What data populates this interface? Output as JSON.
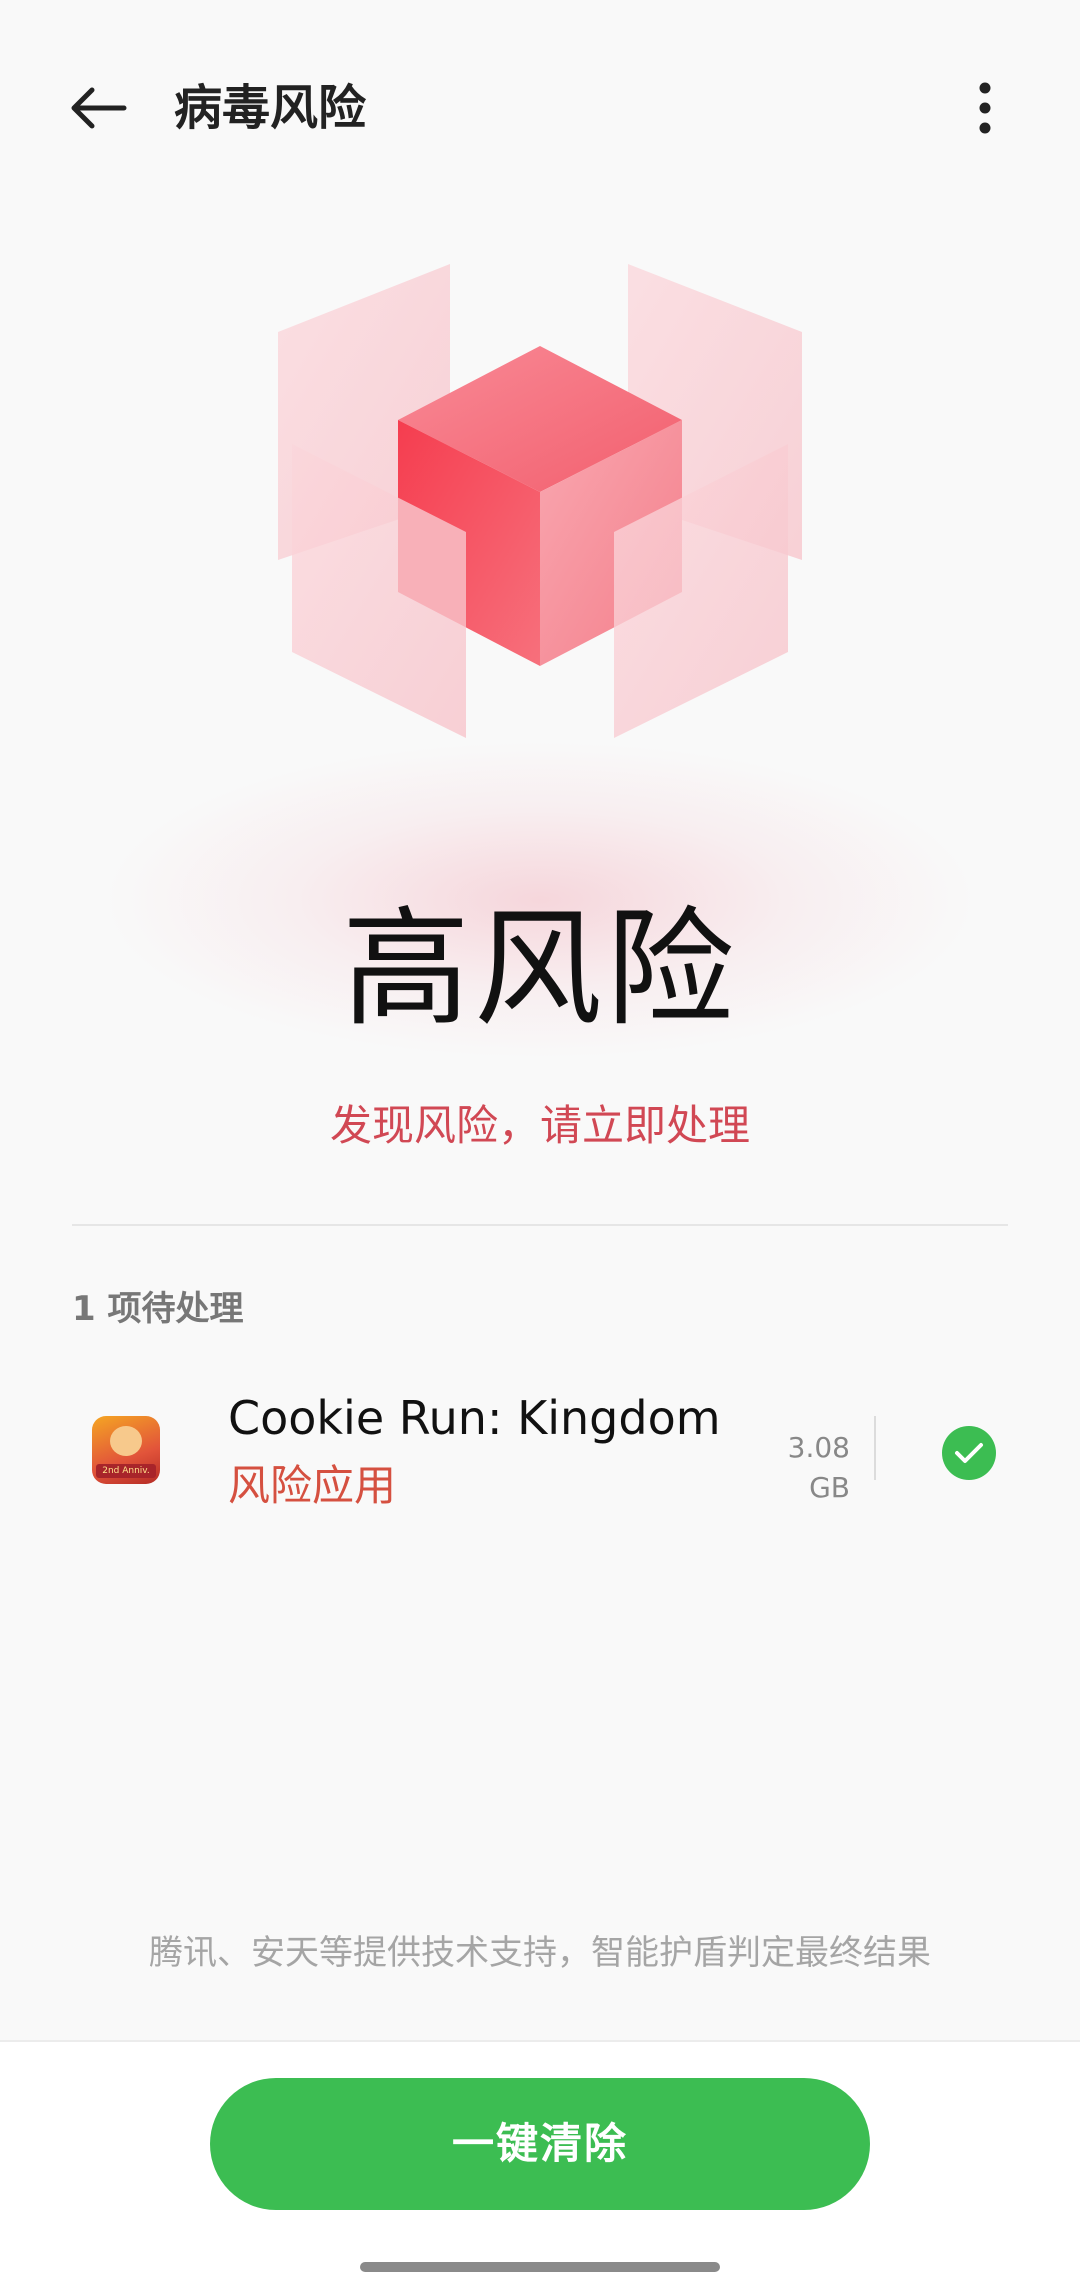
{
  "header": {
    "title": "病毒风险",
    "back_icon": "arrow-left-icon",
    "more_icon": "more-vertical-icon"
  },
  "status": {
    "level": "高风险",
    "message": "发现风险，请立即处理",
    "accent_color": "#d14854"
  },
  "pending": {
    "header": "1 项待处理",
    "items": [
      {
        "name": "Cookie Run: Kingdom",
        "tag": "风险应用",
        "size": "3.08 GB",
        "icon_badge": "2nd Anniv.",
        "selected": true
      }
    ]
  },
  "footer": {
    "note": "腾讯、安天等提供技术支持，智能护盾判定最终结果",
    "primary_button": "一键清除",
    "button_color": "#3cbd52"
  }
}
